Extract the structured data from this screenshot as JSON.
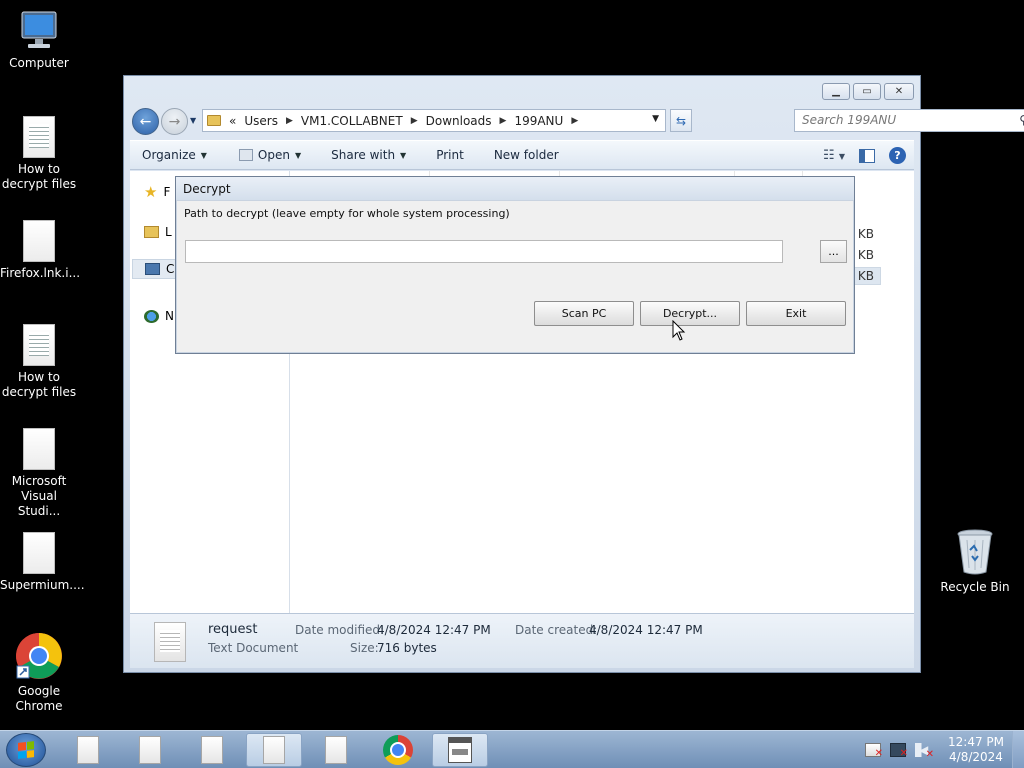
{
  "desktop": {
    "icons": [
      {
        "label": "Computer"
      },
      {
        "label": "How to decrypt files"
      },
      {
        "label": "Firefox.lnk.i..."
      },
      {
        "label": "How to decrypt files"
      },
      {
        "label": "Microsoft Visual Studi..."
      },
      {
        "label": "Supermium...."
      },
      {
        "label": "Google Chrome"
      },
      {
        "label": "Recycle Bin"
      }
    ]
  },
  "explorer": {
    "breadcrumb": [
      "«",
      "Users",
      "VM1.COLLABNET",
      "Downloads",
      "199ANU"
    ],
    "search_placeholder": "Search 199ANU",
    "toolbar": {
      "organize": "Organize",
      "open": "Open",
      "share_with": "Share with",
      "print": "Print",
      "new_folder": "New folder"
    },
    "nav_items": [
      "F",
      "L",
      "C",
      "N"
    ],
    "sizes": [
      "KB",
      "KB",
      "KB"
    ],
    "details": {
      "name": "request",
      "type": "Text Document",
      "date_modified_label": "Date modified:",
      "date_modified": "4/8/2024 12:47 PM",
      "date_created_label": "Date created:",
      "date_created": "4/8/2024 12:47 PM",
      "size_label": "Size:",
      "size": "716 bytes"
    }
  },
  "dialog": {
    "title": "Decrypt",
    "label": "Path to decrypt (leave empty for whole system processing)",
    "path_value": "",
    "browse_label": "...",
    "scan_label": "Scan PC",
    "decrypt_label": "Decrypt...",
    "exit_label": "Exit"
  },
  "taskbar": {
    "time": "12:47 PM",
    "date": "4/8/2024"
  }
}
